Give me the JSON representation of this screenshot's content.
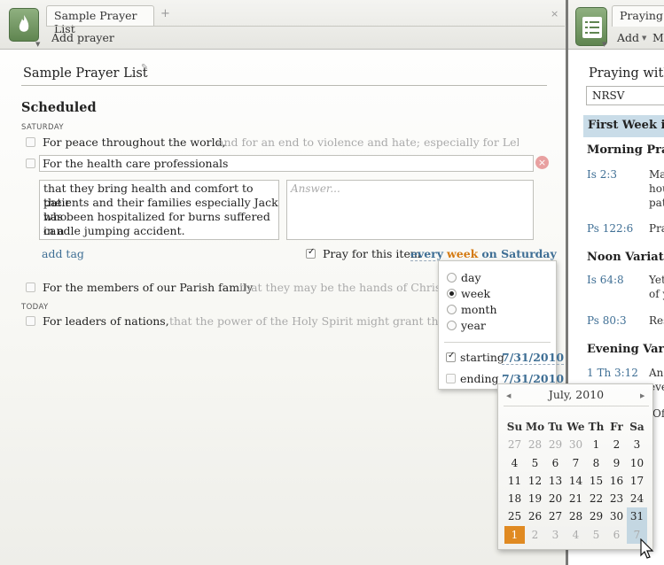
{
  "left_tab": {
    "title": "Sample Prayer List",
    "plus": "+",
    "close": "×"
  },
  "left_toolbar": {
    "add_prayer": "Add prayer"
  },
  "list": {
    "title": "Sample Prayer List",
    "section": "Scheduled",
    "day_saturday": "SATURDAY",
    "day_today": "TODAY",
    "items": [
      {
        "text": "For peace throughout the world,",
        "note": "and for an end to violence and hate; especially for Lebanon,..."
      },
      {
        "text": "For the members of our Parish family",
        "note": "that they may be the hands of Christ Jesus"
      },
      {
        "text": "For leaders of nations,",
        "note": "that the power of the Holy Spirit might grant them the"
      }
    ],
    "editing": {
      "title_value": "For the health care professionals",
      "description_lines": [
        "that they bring health and comfort to their",
        "patients and their families especially Jack who",
        "has been hospitalized for burns suffered in a",
        "candle jumping accident."
      ],
      "answer_placeholder": "Answer...",
      "add_tag": "add tag",
      "pray_label": "Pray for this item",
      "every": "every",
      "unit": "week",
      "on": "on Saturday"
    }
  },
  "schedule": {
    "options": [
      "day",
      "week",
      "month",
      "year"
    ],
    "selected": "week",
    "starting_label": "starting",
    "starting_date": "7/31/2010",
    "starting_checked": true,
    "ending_label": "ending",
    "ending_date": "7/31/2010",
    "ending_checked": false
  },
  "calendar": {
    "month_label": "July, 2010",
    "weekdays": [
      "Su",
      "Mo",
      "Tu",
      "We",
      "Th",
      "Fr",
      "Sa"
    ],
    "weeks": [
      [
        [
          "27",
          true
        ],
        [
          "28",
          true
        ],
        [
          "29",
          true
        ],
        [
          "30",
          true
        ],
        [
          "1",
          false
        ],
        [
          "2",
          false
        ],
        [
          "3",
          false
        ]
      ],
      [
        [
          "4",
          false
        ],
        [
          "5",
          false
        ],
        [
          "6",
          false
        ],
        [
          "7",
          false
        ],
        [
          "8",
          false
        ],
        [
          "9",
          false
        ],
        [
          "10",
          false
        ]
      ],
      [
        [
          "11",
          false
        ],
        [
          "12",
          false
        ],
        [
          "13",
          false
        ],
        [
          "14",
          false
        ],
        [
          "15",
          false
        ],
        [
          "16",
          false
        ],
        [
          "17",
          false
        ]
      ],
      [
        [
          "18",
          false
        ],
        [
          "19",
          false
        ],
        [
          "20",
          false
        ],
        [
          "21",
          false
        ],
        [
          "22",
          false
        ],
        [
          "23",
          false
        ],
        [
          "24",
          false
        ]
      ],
      [
        [
          "25",
          false
        ],
        [
          "26",
          false
        ],
        [
          "27",
          false
        ],
        [
          "28",
          false
        ],
        [
          "29",
          false
        ],
        [
          "30",
          false
        ],
        [
          "31",
          false
        ]
      ],
      [
        [
          "1",
          true
        ],
        [
          "2",
          true
        ],
        [
          "3",
          true
        ],
        [
          "4",
          true
        ],
        [
          "5",
          true
        ],
        [
          "6",
          true
        ],
        [
          "7",
          true
        ]
      ]
    ],
    "selected_day": "31",
    "today_label": "1"
  },
  "right_pane": {
    "tab_title": "Praying w",
    "toolbar": [
      "Add",
      "Me"
    ],
    "heading": "Praying with",
    "version": "NRSV",
    "band": "First Week in A",
    "sections": [
      {
        "title": "Morning Praye",
        "rows": [
          {
            "ref": "Is 2:3",
            "lines": [
              "Ma",
              "hou",
              "pat"
            ]
          },
          {
            "ref": "Ps 122:6",
            "lines": [
              "Pra"
            ]
          }
        ]
      },
      {
        "title": "Noon Variation",
        "rows": [
          {
            "ref": "Is 64:8",
            "lines": [
              "Yet",
              "of y"
            ]
          },
          {
            "ref": "Ps 80:3",
            "lines": [
              "Res"
            ]
          }
        ]
      },
      {
        "title": "Evening Variat",
        "rows": [
          {
            "ref": "1 Th 3:12",
            "lines": [
              "And",
              "eve"
            ]
          }
        ]
      }
    ],
    "partial": "Off"
  },
  "colors": {
    "accent_blue": "#3f6f95",
    "accent_orange": "#d47a12",
    "today_bg": "#e08a22",
    "band_bg": "#c9dce8"
  }
}
